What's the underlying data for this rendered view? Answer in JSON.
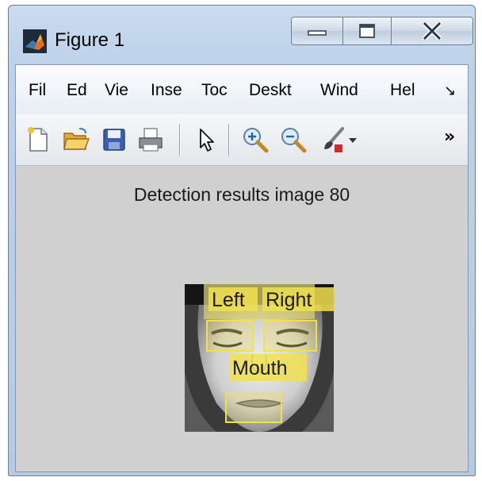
{
  "window": {
    "title": "Figure 1",
    "controls": [
      "minimize",
      "maximize",
      "close"
    ]
  },
  "menubar": {
    "items": [
      "Fil",
      "Ed",
      "Vie",
      "Inse",
      "Toc",
      "Deskt",
      "Wind",
      "Hel"
    ],
    "overflow_glyph": "↘"
  },
  "toolbar": {
    "icons": [
      "new-file-icon",
      "open-folder-icon",
      "save-icon",
      "print-icon",
      "select-arrow-icon",
      "zoom-in-icon",
      "zoom-out-icon",
      "brush-icon"
    ],
    "overflow_glyph": "»"
  },
  "figure": {
    "title": "Detection results image 80",
    "detection_labels": [
      "Left",
      "Right",
      "Mouth"
    ]
  },
  "colors": {
    "figure_background": "#d0d0d0",
    "detection_box": "#f0e050",
    "close_glyph": "#2f3a48"
  }
}
